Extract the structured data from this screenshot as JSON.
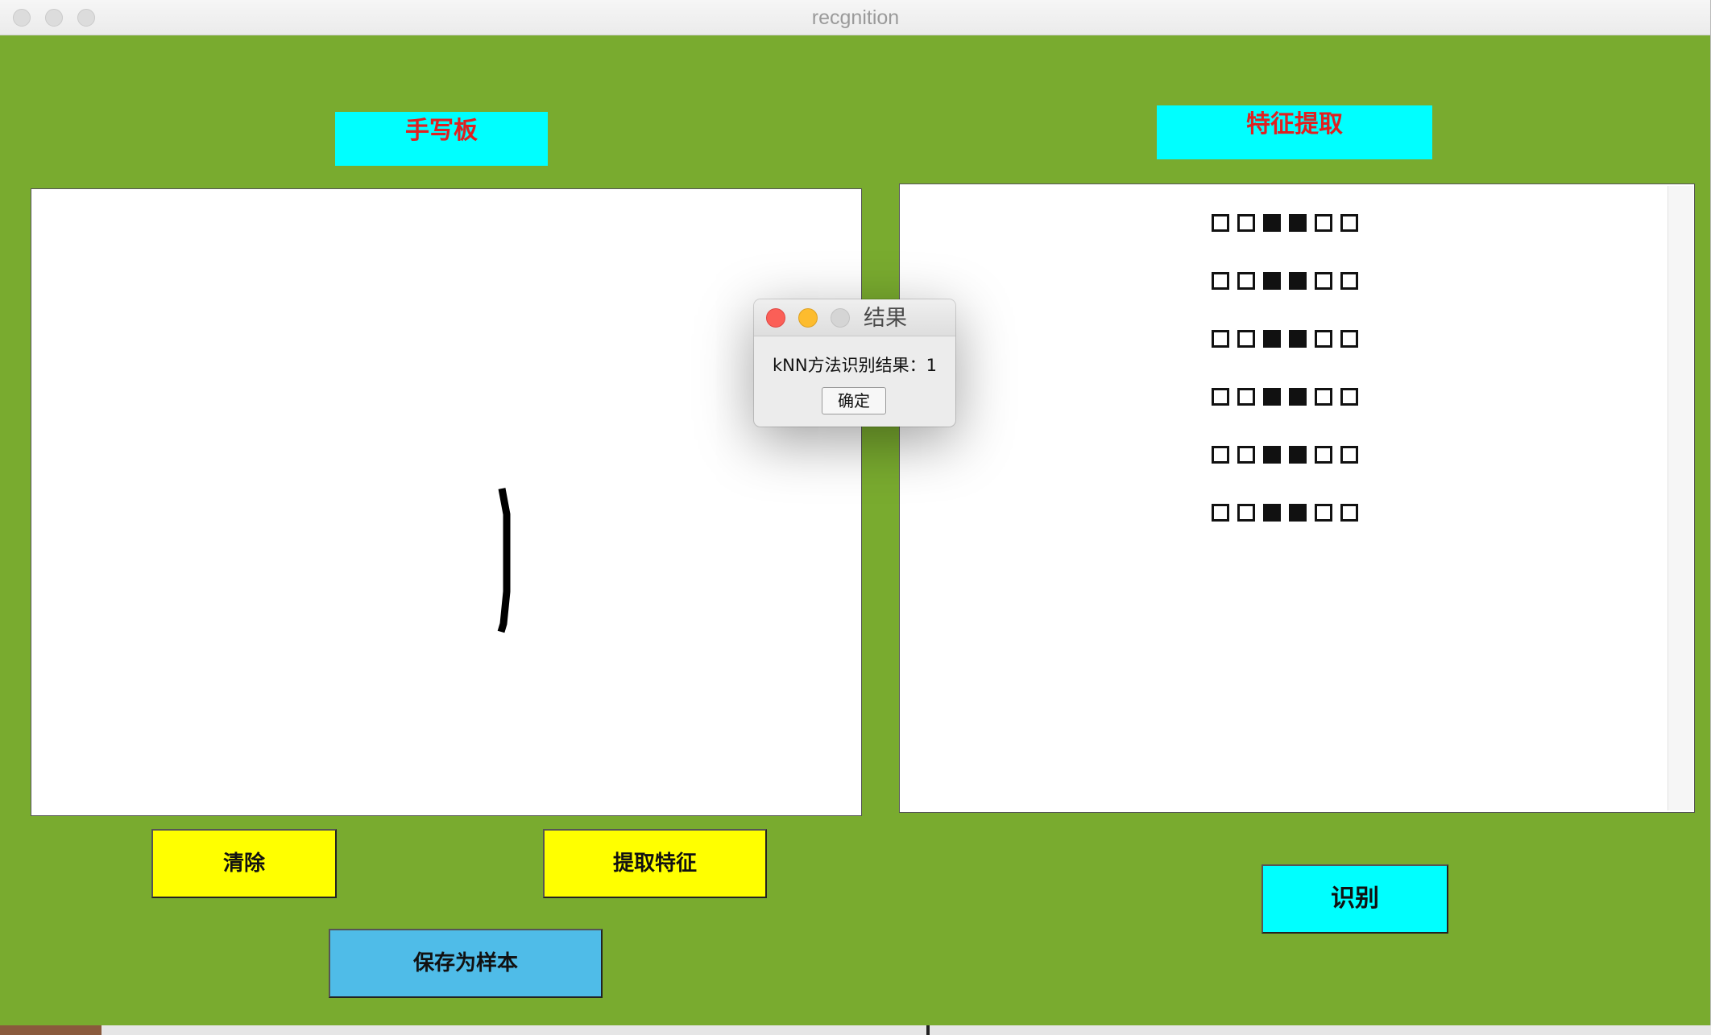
{
  "window": {
    "title": "recgnition"
  },
  "handwriting_panel": {
    "label": "手写板",
    "buttons": {
      "clear": "清除",
      "extract": "提取特征",
      "save": "保存为样本"
    }
  },
  "feature_panel": {
    "label": "特征提取",
    "grid": [
      [
        0,
        0,
        1,
        1,
        0,
        0
      ],
      [
        0,
        0,
        1,
        1,
        0,
        0
      ],
      [
        0,
        0,
        1,
        1,
        0,
        0
      ],
      [
        0,
        0,
        1,
        1,
        0,
        0
      ],
      [
        0,
        0,
        1,
        1,
        0,
        0
      ],
      [
        0,
        0,
        1,
        1,
        0,
        0
      ]
    ],
    "recognize_button": "识别"
  },
  "dialog": {
    "title": "结果",
    "message": "kNN方法识别结果：1",
    "ok_button": "确定"
  },
  "colors": {
    "window_bg": "#79ab2f",
    "label_bg": "#00ffff",
    "label_text": "#e02020",
    "button_yellow": "#ffff00",
    "button_blue": "#4fbce8",
    "button_cyan": "#00ffff"
  }
}
